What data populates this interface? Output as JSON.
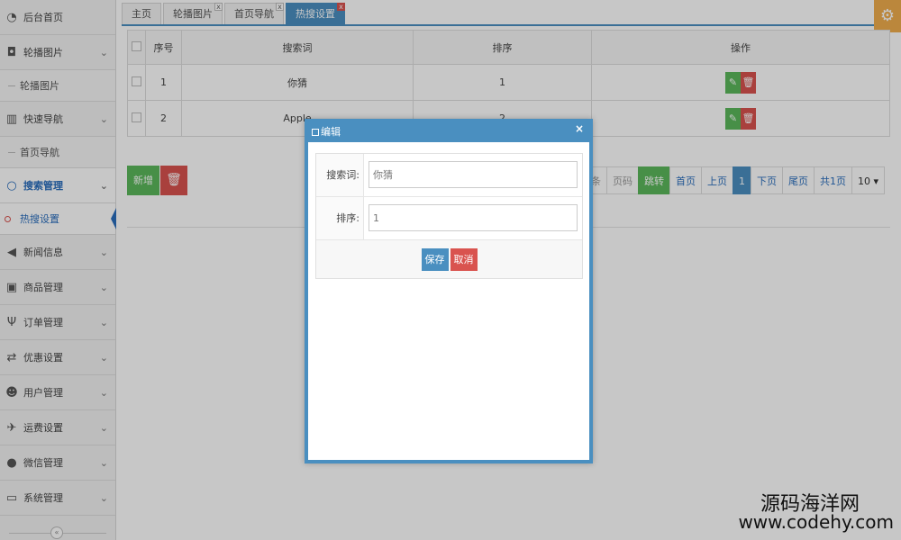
{
  "sidebar": {
    "items": [
      {
        "label": "后台首页",
        "icon": "dashboard-icon",
        "type": "top"
      },
      {
        "label": "轮播图片",
        "icon": "camera-icon",
        "type": "group"
      },
      {
        "label": "轮播图片",
        "type": "sub"
      },
      {
        "label": "快速导航",
        "icon": "barcode-icon",
        "type": "group"
      },
      {
        "label": "首页导航",
        "type": "sub"
      },
      {
        "label": "搜索管理",
        "icon": "circle-icon",
        "type": "group-active"
      },
      {
        "label": "热搜设置",
        "type": "sub-active"
      },
      {
        "label": "新闻信息",
        "icon": "bullhorn-icon",
        "type": "group"
      },
      {
        "label": "商品管理",
        "icon": "gift-icon",
        "type": "group"
      },
      {
        "label": "订单管理",
        "icon": "cutlery-icon",
        "type": "group"
      },
      {
        "label": "优惠设置",
        "icon": "exchange-icon",
        "type": "group"
      },
      {
        "label": "用户管理",
        "icon": "users-icon",
        "type": "group"
      },
      {
        "label": "运费设置",
        "icon": "plane-icon",
        "type": "group"
      },
      {
        "label": "微信管理",
        "icon": "comments-icon",
        "type": "group"
      },
      {
        "label": "系统管理",
        "icon": "desktop-icon",
        "type": "group"
      }
    ]
  },
  "tabs": [
    {
      "label": "主页",
      "closable": false,
      "active": false
    },
    {
      "label": "轮播图片",
      "closable": true,
      "active": false
    },
    {
      "label": "首页导航",
      "closable": true,
      "active": false
    },
    {
      "label": "热搜设置",
      "closable": true,
      "active": true
    }
  ],
  "table": {
    "headers": [
      "序号",
      "搜索词",
      "排序",
      "操作"
    ],
    "rows": [
      {
        "no": "1",
        "keyword": "你猜",
        "order": "1"
      },
      {
        "no": "2",
        "keyword": "Apple",
        "order": "2"
      }
    ]
  },
  "actions": {
    "add_label": "新增"
  },
  "pager": {
    "items": [
      "条",
      "页码",
      "跳转",
      "首页",
      "上页",
      "1",
      "下页",
      "尾页",
      "共1页",
      "10 ▾"
    ]
  },
  "modal": {
    "title": "编辑",
    "close": "×",
    "fields": [
      {
        "label": "搜索词:",
        "value": "你猜"
      },
      {
        "label": "排序:",
        "value": "1"
      }
    ],
    "save_label": "保存",
    "cancel_label": "取消"
  },
  "watermark": {
    "line1": "源码海洋网",
    "line2": "www.codehy.com"
  },
  "colors": {
    "primary": "#4a8fc0",
    "success": "#5cb85c",
    "danger": "#d9534f",
    "warning": "#f0ad4e"
  }
}
